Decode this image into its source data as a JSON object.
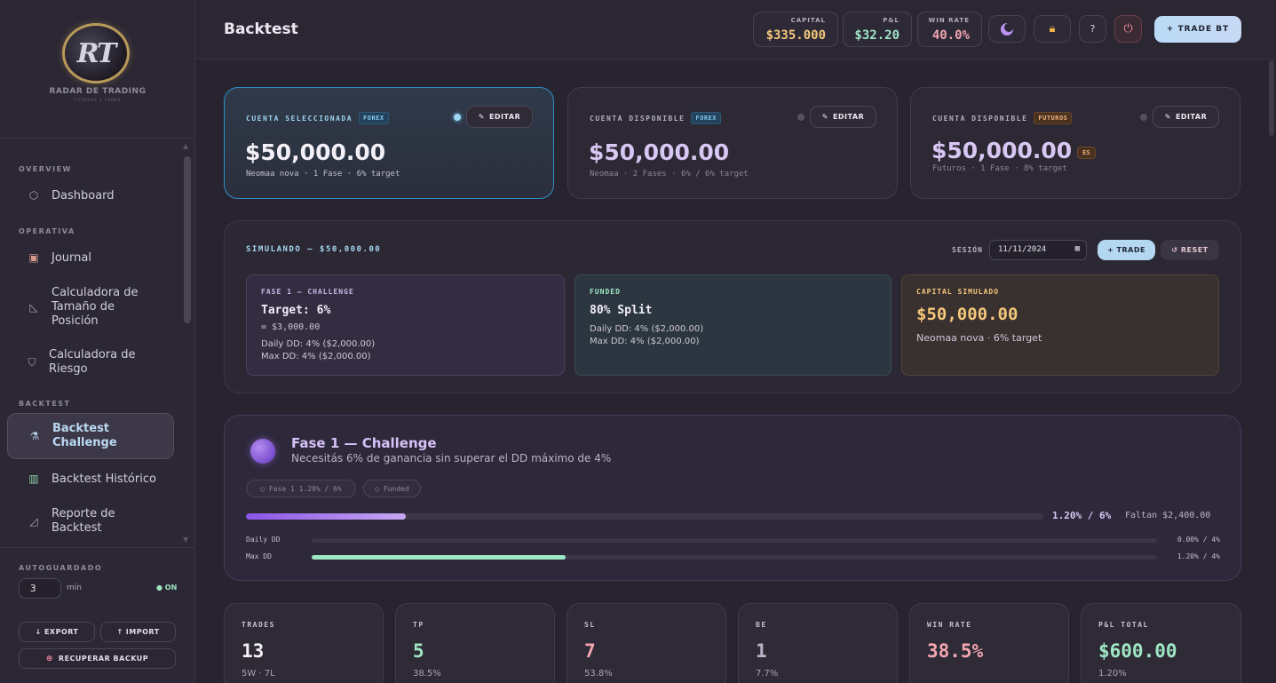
{
  "sidebar": {
    "logo": {
      "monogram": "RT",
      "name": "RADAR DE TRADING",
      "tagline": "FUTUROS Y FOREX"
    },
    "sections": {
      "overview": "OVERVIEW",
      "operativa": "OPERATIVA",
      "backtest": "BACKTEST"
    },
    "items": [
      {
        "label": "Dashboard",
        "icon": "hexagon-icon"
      },
      {
        "label": "Journal",
        "icon": "notebook-icon"
      },
      {
        "label": "Calculadora de Tamaño de Posición",
        "icon": "ruler-triangle-icon"
      },
      {
        "label": "Calculadora de Riesgo",
        "icon": "shield-icon"
      },
      {
        "label": "Backtest Challenge",
        "icon": "microscope-icon",
        "active": true
      },
      {
        "label": "Backtest Histórico",
        "icon": "books-icon"
      },
      {
        "label": "Reporte de Backtest",
        "icon": "chart-icon"
      }
    ],
    "autosave": {
      "label": "AUTOGUARDADO",
      "value": "3",
      "unit": "min",
      "status": "● ON"
    },
    "buttons": {
      "export": "↓ EXPORT",
      "import": "↑ IMPORT",
      "recover": "RECUPERAR BACKUP"
    }
  },
  "header": {
    "title": "Backtest",
    "stats": [
      {
        "label": "CAPITAL",
        "value": "$335.000",
        "color": "#f5c77a"
      },
      {
        "label": "P&L",
        "value": "$32.20",
        "color": "#9fe7c4"
      },
      {
        "label": "WIN RATE",
        "value": "40.0%",
        "color": "#f2a6b0"
      }
    ],
    "icons": [
      "moon-icon",
      "lock-icon",
      "help-icon",
      "power-icon"
    ],
    "help_glyph": "?",
    "trade_bt": "+ TRADE BT"
  },
  "accounts": [
    {
      "head": "CUENTA SELECCIONADA",
      "tag": "FOREX",
      "amount": "$50,000.00",
      "desc": "Neomaa nova · 1 Fase · 6% target",
      "edit": "EDITAR",
      "selected": true
    },
    {
      "head": "CUENTA DISPONIBLE",
      "tag": "FOREX",
      "amount": "$50,000.00",
      "desc": "Neomaa · 2 Fases · 6% / 6% target",
      "edit": "EDITAR"
    },
    {
      "head": "CUENTA DISPONIBLE",
      "tag": "FUTUROS",
      "amount": "$50,000.00",
      "extra_tag": "ES",
      "desc": "Futuros · 1 Fase · 8% target",
      "edit": "EDITAR"
    }
  ],
  "simulation": {
    "title": "SIMULANDO — $50,000.00",
    "session_label": "SESIÓN",
    "session_date": "11/11/2024",
    "trade_btn": "+ TRADE",
    "reset_btn": "↺ RESET",
    "boxes": [
      {
        "title": "FASE 1 — CHALLENGE",
        "big": "Target: 6%",
        "lines": [
          "= $3,000.00",
          "Daily DD: 4% ($2,000.00)",
          "Max DD: 4% ($2,000.00)"
        ]
      },
      {
        "title": "FUNDED",
        "big": "80% Split",
        "lines": [
          "Daily DD: 4% ($2,000.00)",
          "Max DD: 4% ($2,000.00)"
        ]
      },
      {
        "title": "CAPITAL SIMULADO",
        "big": "$50,000.00",
        "lines": [
          "Neomaa nova · 6% target"
        ]
      }
    ]
  },
  "phase": {
    "title": "Fase 1 — Challenge",
    "subtitle": "Necesitás 6% de ganancia sin superar el DD máximo de 4%",
    "pills": [
      "○ Fase 1 1.20% / 6%",
      "○ Funded"
    ],
    "progress": {
      "value_text": "1.20% / 6%",
      "remaining": "Faltan $2,400.00",
      "fraction": 0.2
    },
    "daily_dd": {
      "label": "Daily DD",
      "value_text": "0.00% / 4%",
      "fraction": 0.0
    },
    "max_dd": {
      "label": "Max DD",
      "value_text": "1.20% / 4%",
      "fraction": 0.3
    }
  },
  "stats": [
    {
      "label": "TRADES",
      "value": "13",
      "sub": "5W · 7L",
      "color": "#f3f0f7"
    },
    {
      "label": "TP",
      "value": "5",
      "sub": "38.5%",
      "color": "#9fe7c4"
    },
    {
      "label": "SL",
      "value": "7",
      "sub": "53.8%",
      "color": "#f2a6b0"
    },
    {
      "label": "BE",
      "value": "1",
      "sub": "7.7%",
      "color": "#b9b3c6"
    },
    {
      "label": "WIN RATE",
      "value": "38.5%",
      "sub": "",
      "color": "#f2a6b0"
    },
    {
      "label": "P&L TOTAL",
      "value": "$600.00",
      "sub": "1.20%",
      "color": "#9fe7c4"
    }
  ]
}
